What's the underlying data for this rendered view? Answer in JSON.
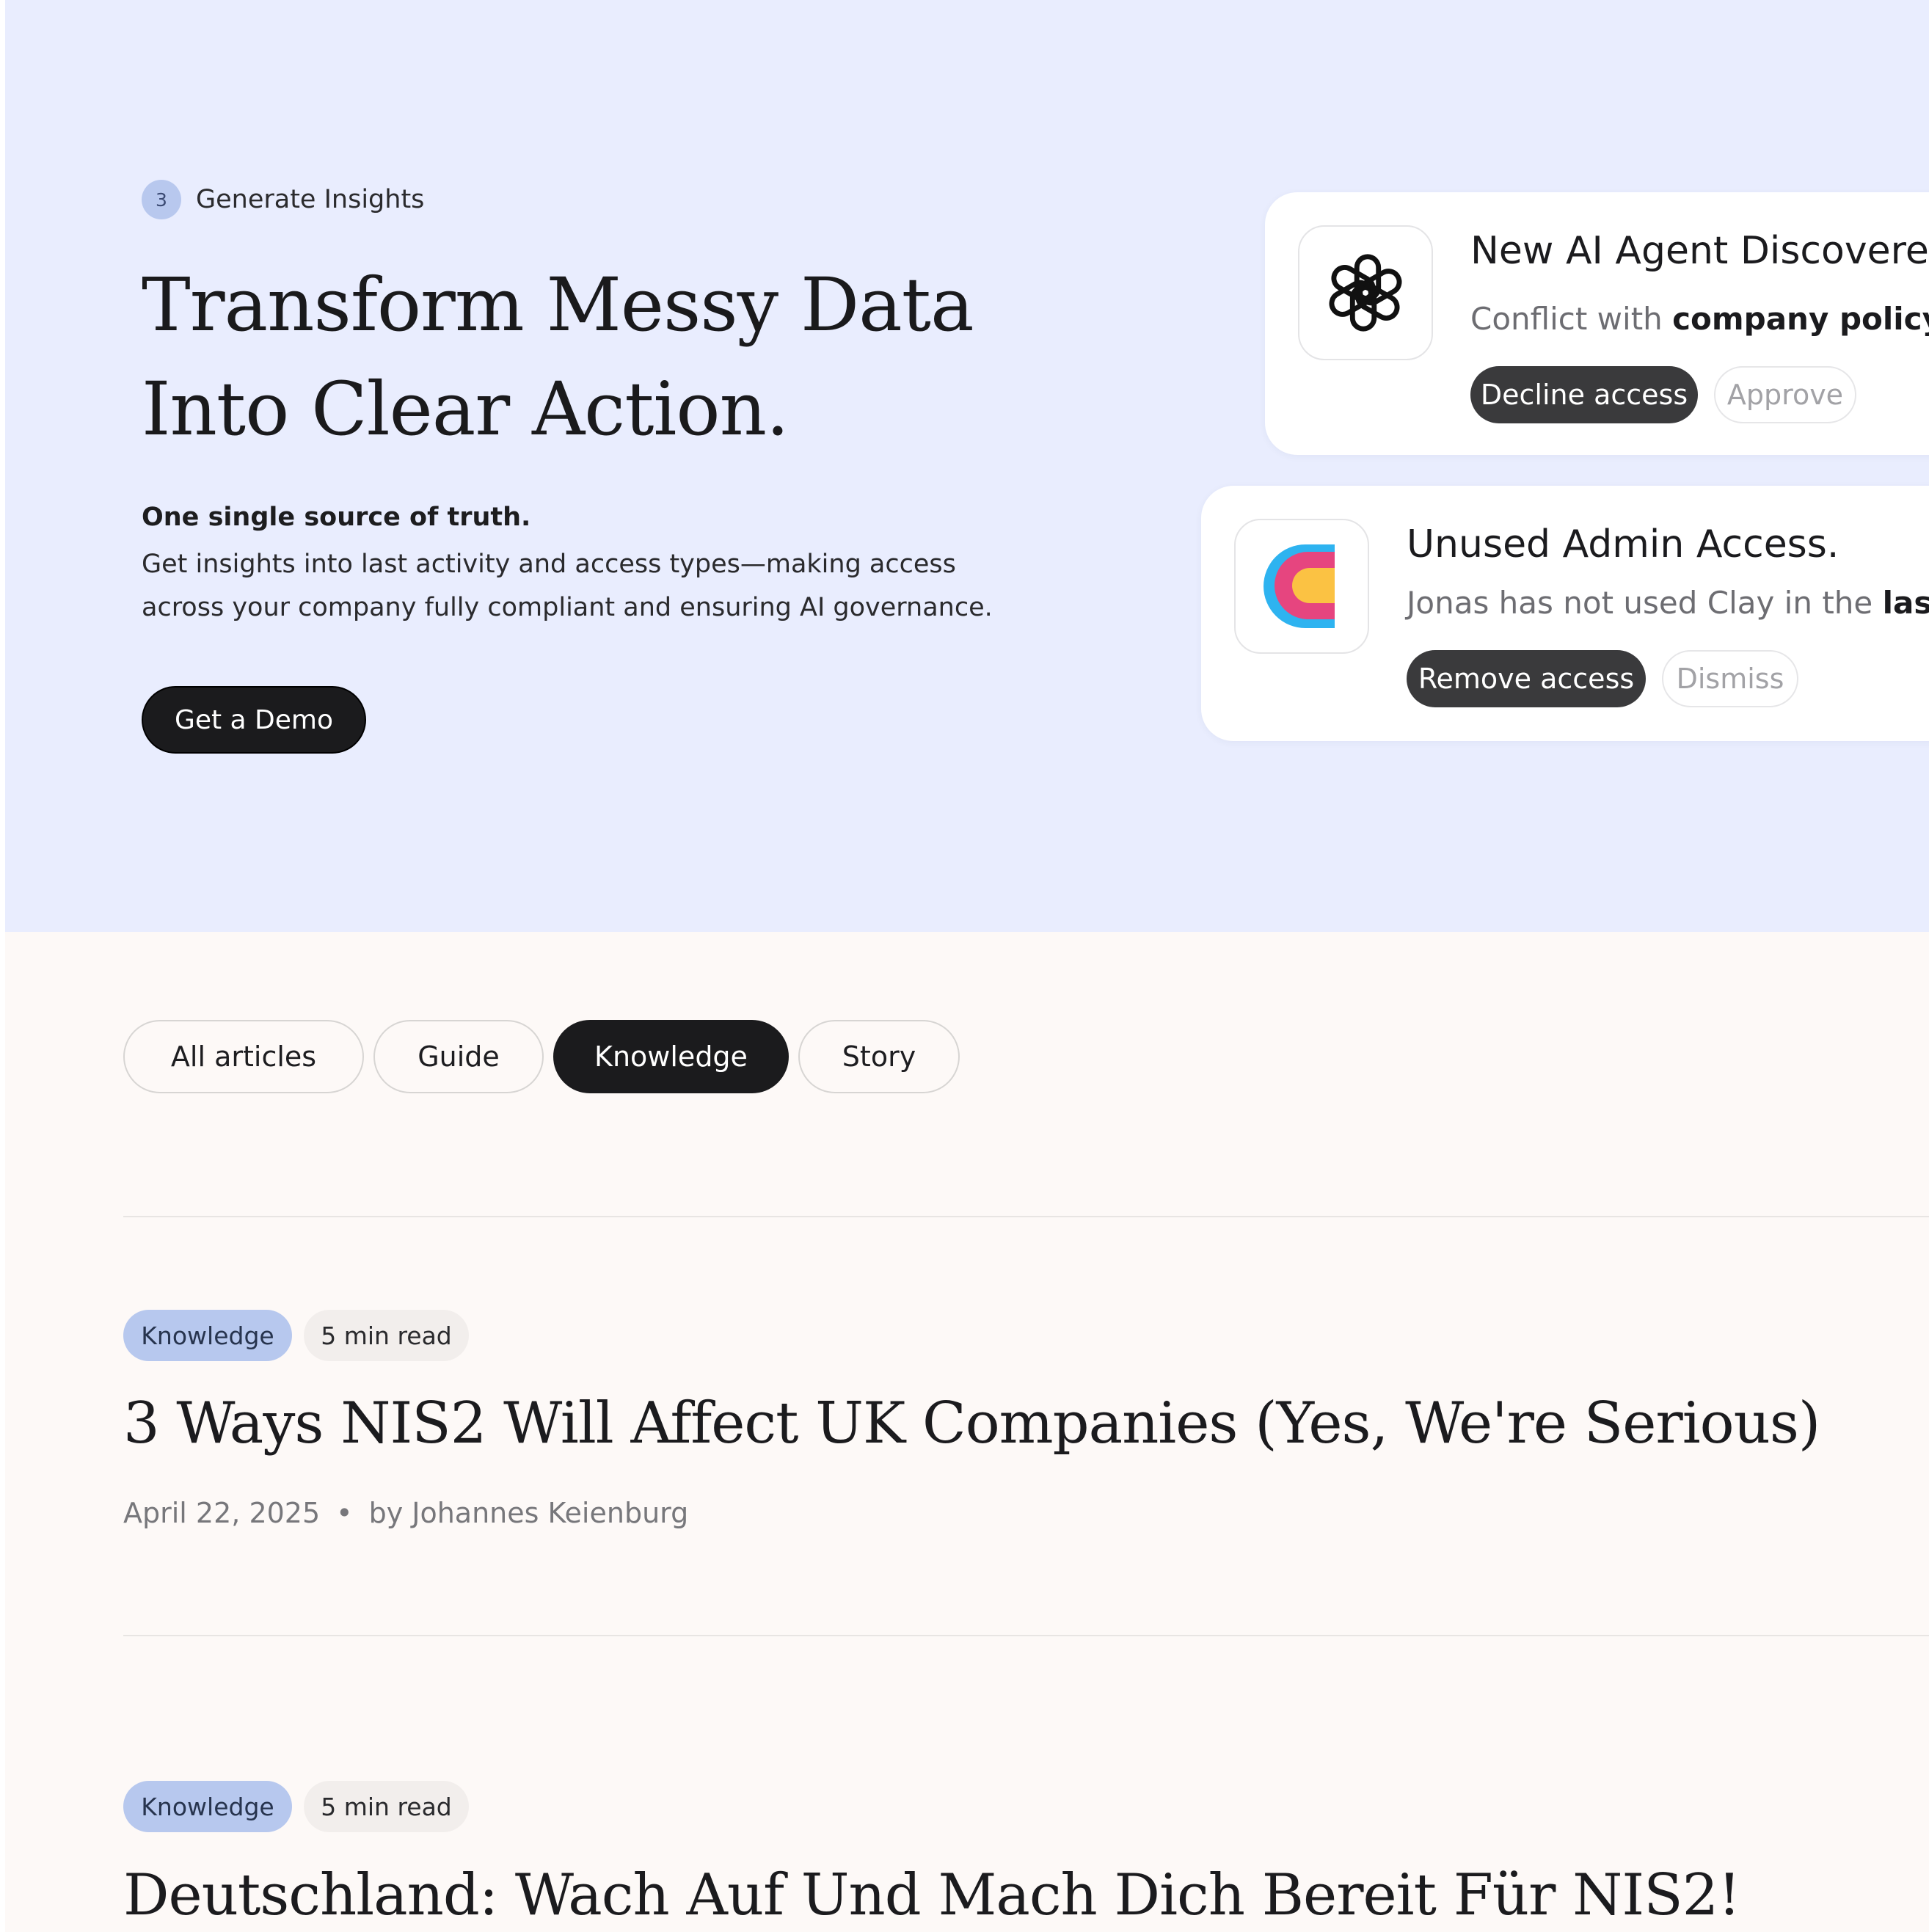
{
  "hero": {
    "step_number": "3",
    "step_label": "Generate Insights",
    "title_line1": "Transform Messy Data",
    "title_line2": "Into Clear Action.",
    "lead": "One single source of truth.",
    "body_line1": "Get insights into last activity and access types—making access",
    "body_line2": "across your company fully compliant and ensuring AI governance.",
    "cta_label": "Get a Demo"
  },
  "cards": [
    {
      "logo": "openai-icon",
      "title": "New AI Agent Discovered",
      "desc_prefix": "Conflict with ",
      "desc_bold": "company policy,",
      "primary_label": "Decline access",
      "secondary_label": "Approve"
    },
    {
      "logo": "clay-icon",
      "title": "Unused Admin Access.",
      "desc_prefix": "Jonas has not used Clay in the ",
      "desc_bold": "last",
      "primary_label": "Remove access",
      "secondary_label": "Dismiss"
    }
  ],
  "filters": [
    {
      "label": "All articles",
      "active": false
    },
    {
      "label": "Guide",
      "active": false
    },
    {
      "label": "Knowledge",
      "active": true
    },
    {
      "label": "Story",
      "active": false
    }
  ],
  "articles": [
    {
      "category": "Knowledge",
      "read_time": "5 min read",
      "title": "3 Ways NIS2 Will Affect UK Companies (Yes, We're Serious)",
      "date": "April 22, 2025",
      "author": "by Johannes Keienburg"
    },
    {
      "category": "Knowledge",
      "read_time": "5 min read",
      "title": "Deutschland: Wach Auf Und Mach Dich Bereit Für NIS2!"
    }
  ],
  "colors": {
    "hero_bg": "#e9edfe",
    "page_bg": "#fdf9f7",
    "dark": "#1b1b1d",
    "tag_blue": "#b7c8ee"
  }
}
